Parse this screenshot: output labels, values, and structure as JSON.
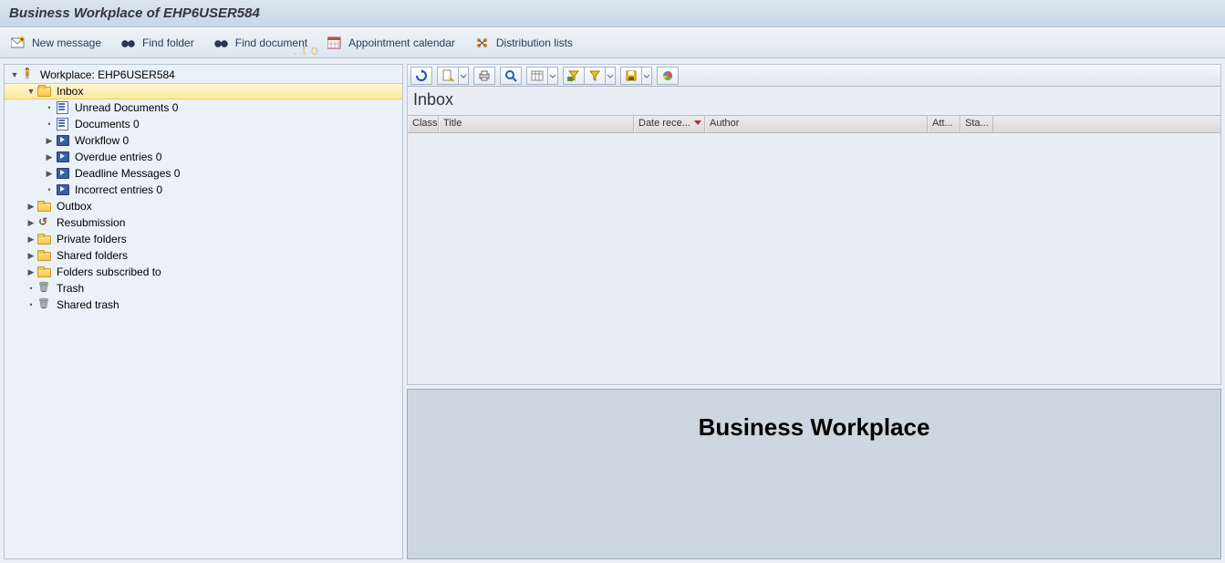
{
  "title": "Business Workplace of EHP6USER584",
  "appbar": {
    "new_message": "New message",
    "find_folder": "Find folder",
    "find_document": "Find document",
    "appointment_calendar": "Appointment calendar",
    "distribution_lists": "Distribution lists"
  },
  "tree": {
    "root": "Workplace: EHP6USER584",
    "inbox": "Inbox",
    "inbox_children": {
      "unread_documents": "Unread Documents 0",
      "documents": "Documents 0",
      "workflow": "Workflow 0",
      "overdue_entries": "Overdue entries 0",
      "deadline_messages": "Deadline Messages 0",
      "incorrect_entries": "Incorrect entries 0"
    },
    "outbox": "Outbox",
    "resubmission": "Resubmission",
    "private_folders": "Private folders",
    "shared_folders": "Shared folders",
    "folders_subscribed": "Folders subscribed to",
    "trash": "Trash",
    "shared_trash": "Shared trash"
  },
  "grid": {
    "title": "Inbox",
    "columns": {
      "class": "Class",
      "title": "Title",
      "date_received": "Date rece...",
      "author": "Author",
      "att": "Att...",
      "status": "Sta..."
    },
    "sort_column": "date_received",
    "sort_dir": "desc",
    "rows": []
  },
  "preview": {
    "heading": "Business Workplace"
  },
  "icons": {
    "new_message": "envelope-new-icon",
    "find_folder": "binoculars-folder-icon",
    "find_document": "binoculars-document-icon",
    "calendar": "calendar-icon",
    "distribution": "distribution-list-icon",
    "refresh": "refresh-icon",
    "display_create": "display-create-icon",
    "print": "print-icon",
    "details": "details-icon",
    "layout": "layout-icon",
    "filter_set": "filter-set-icon",
    "filter": "filter-icon",
    "save_layout": "save-layout-icon",
    "chart": "chart-icon"
  },
  "watermark_artifact": ". t           o"
}
